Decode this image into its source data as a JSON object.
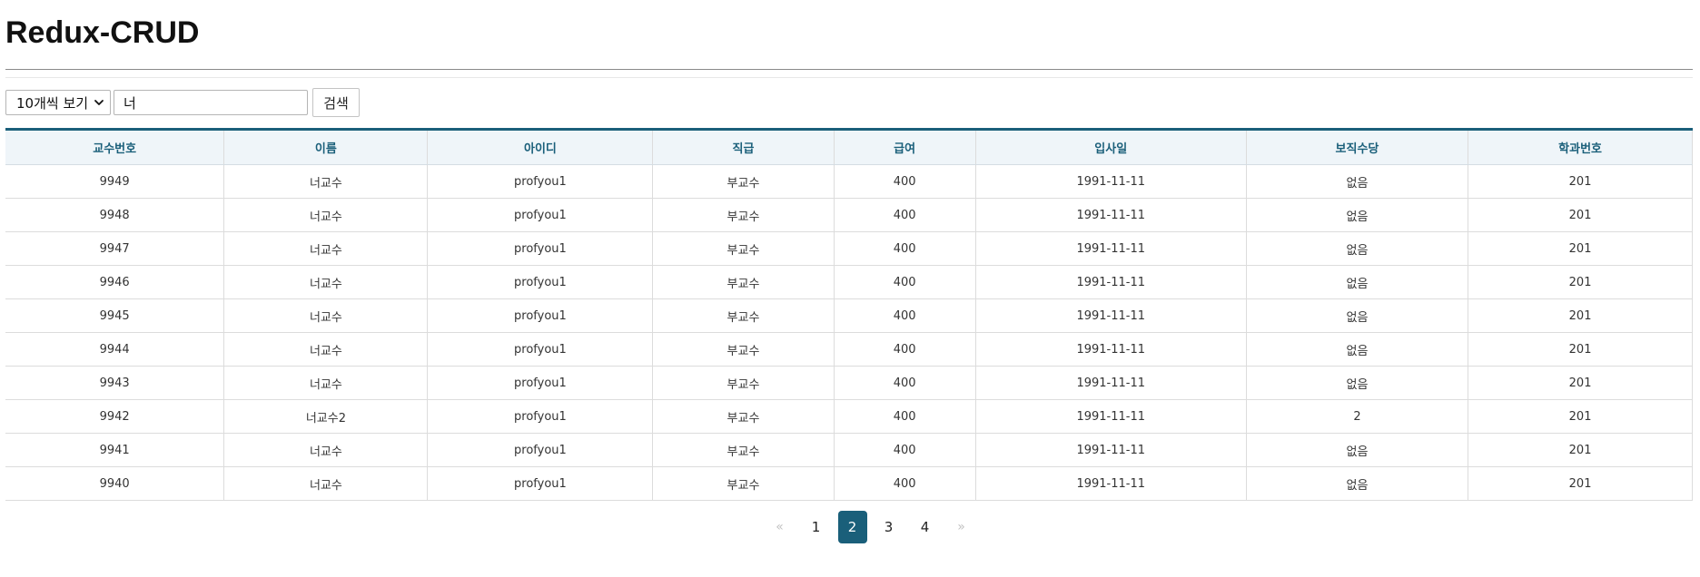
{
  "page": {
    "title": "Redux-CRUD"
  },
  "toolbar": {
    "page_size_selected": "10개씩 보기",
    "search_value": "너",
    "search_button_label": "검색"
  },
  "table": {
    "columns": [
      "교수번호",
      "이름",
      "아이디",
      "직급",
      "급여",
      "입사일",
      "보직수당",
      "학과번호"
    ],
    "rows": [
      [
        "9949",
        "너교수",
        "profyou1",
        "부교수",
        "400",
        "1991-11-11",
        "없음",
        "201"
      ],
      [
        "9948",
        "너교수",
        "profyou1",
        "부교수",
        "400",
        "1991-11-11",
        "없음",
        "201"
      ],
      [
        "9947",
        "너교수",
        "profyou1",
        "부교수",
        "400",
        "1991-11-11",
        "없음",
        "201"
      ],
      [
        "9946",
        "너교수",
        "profyou1",
        "부교수",
        "400",
        "1991-11-11",
        "없음",
        "201"
      ],
      [
        "9945",
        "너교수",
        "profyou1",
        "부교수",
        "400",
        "1991-11-11",
        "없음",
        "201"
      ],
      [
        "9944",
        "너교수",
        "profyou1",
        "부교수",
        "400",
        "1991-11-11",
        "없음",
        "201"
      ],
      [
        "9943",
        "너교수",
        "profyou1",
        "부교수",
        "400",
        "1991-11-11",
        "없음",
        "201"
      ],
      [
        "9942",
        "너교수2",
        "profyou1",
        "부교수",
        "400",
        "1991-11-11",
        "2",
        "201"
      ],
      [
        "9941",
        "너교수",
        "profyou1",
        "부교수",
        "400",
        "1991-11-11",
        "없음",
        "201"
      ],
      [
        "9940",
        "너교수",
        "profyou1",
        "부교수",
        "400",
        "1991-11-11",
        "없음",
        "201"
      ]
    ]
  },
  "pagination": {
    "prev_label": "«",
    "next_label": "»",
    "pages": [
      "1",
      "2",
      "3",
      "4"
    ],
    "current_page": "2"
  },
  "colors": {
    "accent": "#1a5f7a",
    "header_background": "#eff5f9",
    "arrow_disabled": "#c2c2c2"
  },
  "icons": {
    "select_arrow": "chevron-down-icon",
    "prev": "double-chevron-left-icon",
    "next": "double-chevron-right-icon"
  }
}
